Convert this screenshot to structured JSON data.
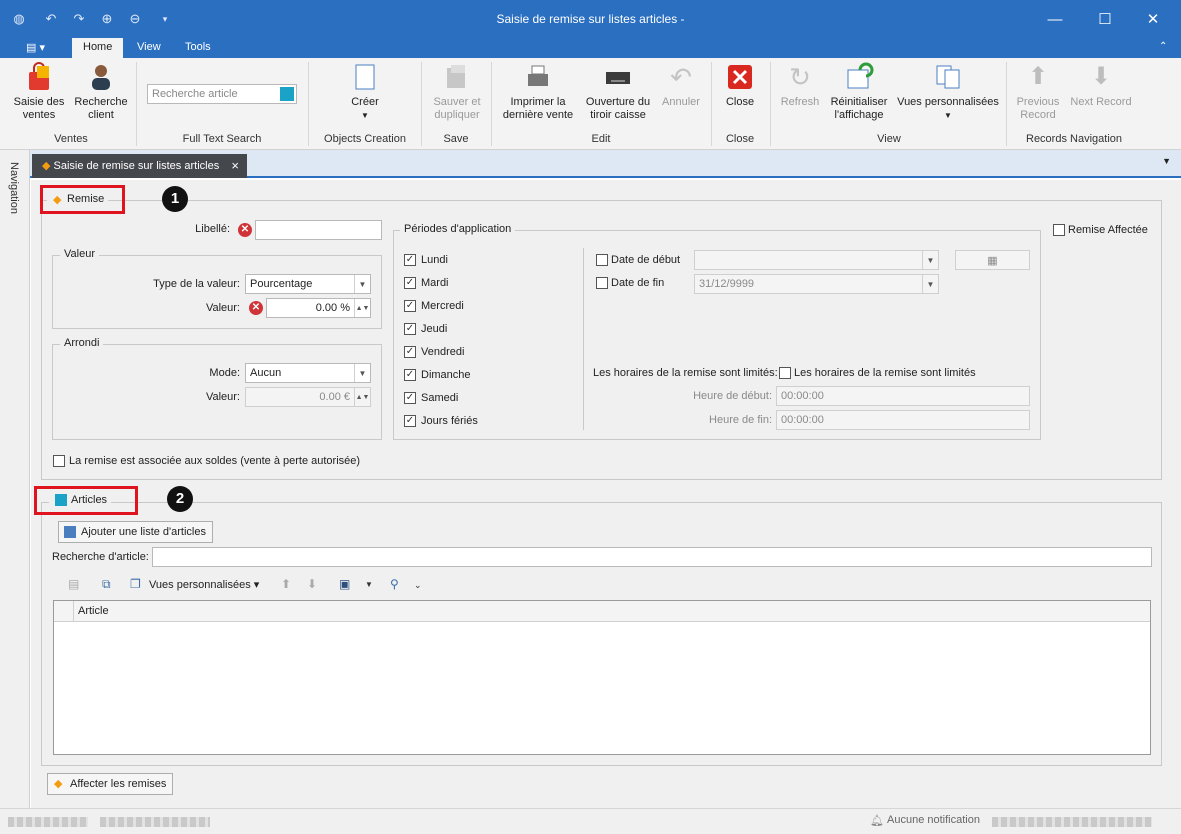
{
  "window": {
    "title": "Saisie de remise sur listes articles - "
  },
  "ribbon_tabs": [
    "Home",
    "View",
    "Tools"
  ],
  "ribbon": {
    "ventes": {
      "saisie_label": "Saisie des\nventes",
      "recherche_label": "Recherche\nclient",
      "group": "Ventes"
    },
    "fulltext": {
      "placeholder": "Recherche article",
      "group": "Full Text Search"
    },
    "objects": {
      "creer_label": "Créer",
      "group": "Objects Creation"
    },
    "save": {
      "label": "Sauver et\ndupliquer",
      "group": "Save"
    },
    "edit": {
      "imprimer_label": "Imprimer la\ndernière vente",
      "ouverture_label": "Ouverture du\ntiroir caisse",
      "annuler_label": "Annuler",
      "group": "Edit"
    },
    "close": {
      "label": "Close",
      "group": "Close"
    },
    "view": {
      "refresh_label": "Refresh",
      "reinit_label": "Réinitialiser\nl'affichage",
      "vues_label": "Vues personnalisées",
      "group": "View"
    },
    "nav": {
      "prev_label": "Previous\nRecord",
      "next_label": "Next Record",
      "group": "Records Navigation"
    }
  },
  "navigation_label": "Navigation",
  "doc_tab": {
    "label": "Saisie de remise sur listes articles",
    "close": "×"
  },
  "remise": {
    "legend": "Remise",
    "badge": "1",
    "libelle_label": "Libellé:",
    "libelle_value": "",
    "valeur_group": "Valeur",
    "type_label": "Type de la valeur:",
    "type_value": "Pourcentage",
    "valeur_label": "Valeur:",
    "valeur_value": "0.00 %",
    "arrondi_group": "Arrondi",
    "mode_label": "Mode:",
    "mode_value": "Aucun",
    "arrondi_valeur_label": "Valeur:",
    "arrondi_valeur_value": "0.00 €",
    "soldes_label": "La remise est associée aux soldes (vente à perte autorisée)",
    "remise_affectee": "Remise Affectée"
  },
  "periodes": {
    "legend": "Périodes d'application",
    "days": [
      "Lundi",
      "Mardi",
      "Mercredi",
      "Jeudi",
      "Vendredi",
      "Dimanche",
      "Samedi",
      "Jours fériés"
    ],
    "date_debut_label": "Date de début",
    "date_debut_value": "",
    "date_fin_label": "Date de fin",
    "date_fin_value": "31/12/9999",
    "horaires_label": "Les horaires de la remise sont limités:",
    "horaires_check_label": "Les horaires de la remise sont limités",
    "heure_debut_label": "Heure de début:",
    "heure_debut_value": "00:00:00",
    "heure_fin_label": "Heure de fin:",
    "heure_fin_value": "00:00:00"
  },
  "articles": {
    "legend": "Articles",
    "badge": "2",
    "ajouter_label": "Ajouter une liste d'articles",
    "recherche_label": "Recherche d'article:",
    "recherche_value": "",
    "vues_label": "Vues personnalisées",
    "col_article": "Article"
  },
  "affecter_label": "Affecter les remises",
  "status": {
    "notification": "Aucune notification"
  }
}
